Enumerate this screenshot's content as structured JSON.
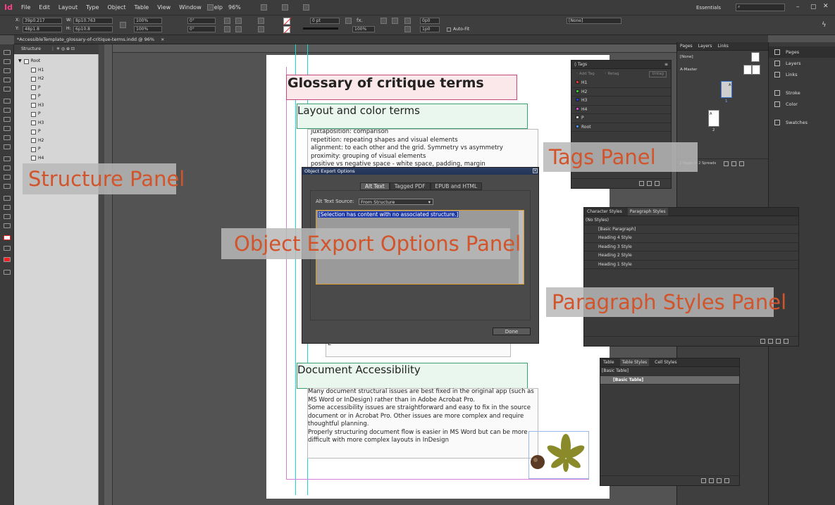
{
  "app": {
    "logo": "Id"
  },
  "menu": [
    "File",
    "Edit",
    "Layout",
    "Type",
    "Object",
    "Table",
    "View",
    "Window",
    "Help"
  ],
  "topbar": {
    "zoom": "96%",
    "workspace": "Essentials",
    "search_placeholder": ""
  },
  "control": {
    "x": "39p0.217",
    "y": "48p1.8",
    "w": "8p10.763",
    "h": "6p10.8",
    "scale_x": "100%",
    "scale_y": "100%",
    "rotate": "0°",
    "shear": "0°",
    "stroke_weight": "0 pt",
    "opacity": "100%",
    "auto_fit": "Auto-Fit",
    "object_style": "[None]",
    "ref_size_a": "0p0",
    "ref_size_b": "1p0"
  },
  "document_tab": "*AccessibleTemplate_glossary-of-critique-terms.indd @ 96%",
  "structure": {
    "title": "Structure",
    "root": "Root",
    "items": [
      "H1",
      "H2",
      "P",
      "P",
      "H3",
      "P",
      "H3",
      "P",
      "H2",
      "P",
      "H4"
    ]
  },
  "page": {
    "glossary_title": "Glossary of critique terms",
    "heading_layout": "Layout and color terms",
    "layout_lines": [
      "juxtaposition: comparison",
      "repetition: repeating shapes and visual elements",
      "alignment: to each other and the grid. Symmetry vs asymmetry",
      "proximity: grouping of  visual elements",
      "positive vs negative space - white space, padding, margin"
    ],
    "hidden_line_letter": "L",
    "heading_accessibility": "Document Accessibility",
    "accessibility_lines": [
      " Many document structural issues are best fixed in the original app (such as",
      "MS Word or InDesign) rather than in Adobe Acrobat Pro.",
      " Some accessibility issues are straightforward and easy to fix in the source",
      "document or in Acrobat Pro. Other issues are more complex and require",
      "thoughtful planning.",
      " Properly structuring document flow is easier in MS Word but can be more",
      "difficult with more complex layouts in InDesign"
    ]
  },
  "object_export": {
    "title": "Object Export Options",
    "tabs": [
      "Alt Text",
      "Tagged PDF",
      "EPUB and HTML"
    ],
    "alt_source_label": "Alt Text Source:",
    "alt_source_value": "From Structure",
    "text_value": "[Selection has content with no associated structure.]",
    "done": "Done"
  },
  "tags_panel": {
    "title": "Tags",
    "add_tag": "Add Tag",
    "retag": "Retag",
    "untag": "Untag",
    "tags": [
      {
        "name": "H1",
        "color": "#e0342f"
      },
      {
        "name": "H2",
        "color": "#39c43a"
      },
      {
        "name": "H3",
        "color": "#2340c8"
      },
      {
        "name": "H4",
        "color": "#d04fd0"
      },
      {
        "name": "P",
        "color": "#c8c8c8"
      },
      {
        "name": "Root",
        "color": "#4a90e2"
      }
    ]
  },
  "pages_panel": {
    "tabs": [
      "Pages",
      "Layers",
      "Links"
    ],
    "none_master": "[None]",
    "a_master": "A-Master",
    "page1": "1",
    "page2": "2",
    "thumb_letter": "A",
    "status": "2 Pages in 2 Spreads"
  },
  "dock": [
    "Pages",
    "Layers",
    "Links",
    "Stroke",
    "Color",
    "Swatches"
  ],
  "para_panel": {
    "tabs": [
      "Character Styles",
      "Paragraph Styles"
    ],
    "current": "(No Styles)",
    "items": [
      "[Basic Paragraph]",
      "Heading 4 Style",
      "Heading 3 Style",
      "Heading 2 Style",
      "Heading 1 Style"
    ]
  },
  "table_panel": {
    "tabs": [
      "Table",
      "Table Styles",
      "Cell Styles"
    ],
    "current": "[Basic Table]",
    "items": [
      "[Basic Table]"
    ]
  },
  "callouts": {
    "structure": "Structure Panel",
    "object_export": "Object Export Options Panel",
    "tags": "Tags Panel",
    "paragraph": "Paragraph Styles Panel"
  }
}
